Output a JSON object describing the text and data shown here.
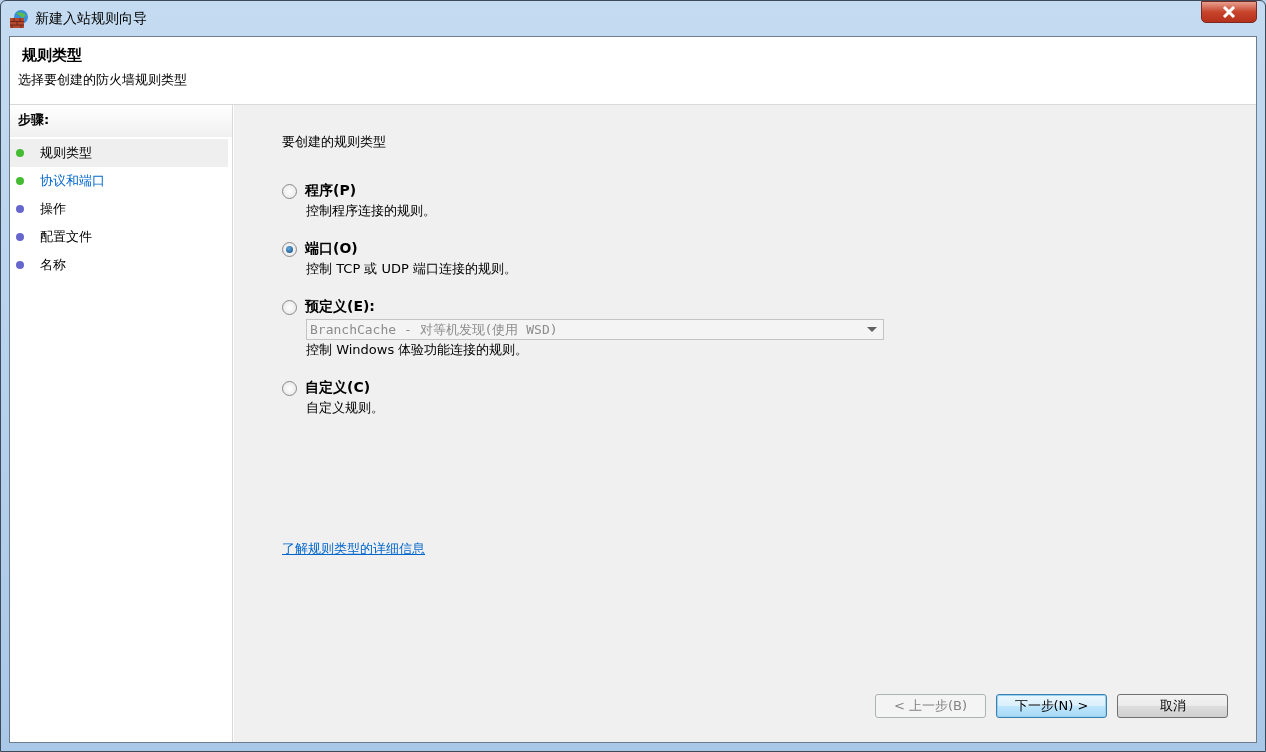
{
  "window": {
    "title": "新建入站规则向导"
  },
  "header": {
    "title": "规则类型",
    "subtitle": "选择要创建的防火墙规则类型"
  },
  "steps": {
    "title": "步骤:",
    "items": [
      {
        "label": "规则类型",
        "selected": true,
        "kind": "text",
        "color": "#44bb33"
      },
      {
        "label": "协议和端口",
        "selected": false,
        "kind": "link",
        "color": "#44bb33"
      },
      {
        "label": "操作",
        "selected": false,
        "kind": "text",
        "color": "#6666cc"
      },
      {
        "label": "配置文件",
        "selected": false,
        "kind": "text",
        "color": "#6666cc"
      },
      {
        "label": "名称",
        "selected": false,
        "kind": "text",
        "color": "#6666cc"
      }
    ]
  },
  "prompt": "要创建的规则类型",
  "options": [
    {
      "label": "程序(P)",
      "description": "控制程序连接的规则。",
      "selected": false
    },
    {
      "label": "端口(O)",
      "description": "控制 TCP 或 UDP 端口连接的规则。",
      "selected": true
    },
    {
      "label": "预定义(E):",
      "description": "控制 Windows 体验功能连接的规则。",
      "selected": false,
      "dropdown": {
        "value": "BranchCache - 对等机发现(使用 WSD)",
        "disabled": true
      }
    },
    {
      "label": "自定义(C)",
      "description": "自定义规则。",
      "selected": false
    }
  ],
  "help_link": "了解规则类型的详细信息",
  "buttons": [
    {
      "label": "< 上一步(B)",
      "disabled": true,
      "default": false
    },
    {
      "label": "下一步(N) >",
      "disabled": false,
      "default": true
    },
    {
      "label": "取消",
      "disabled": false,
      "default": false
    }
  ]
}
